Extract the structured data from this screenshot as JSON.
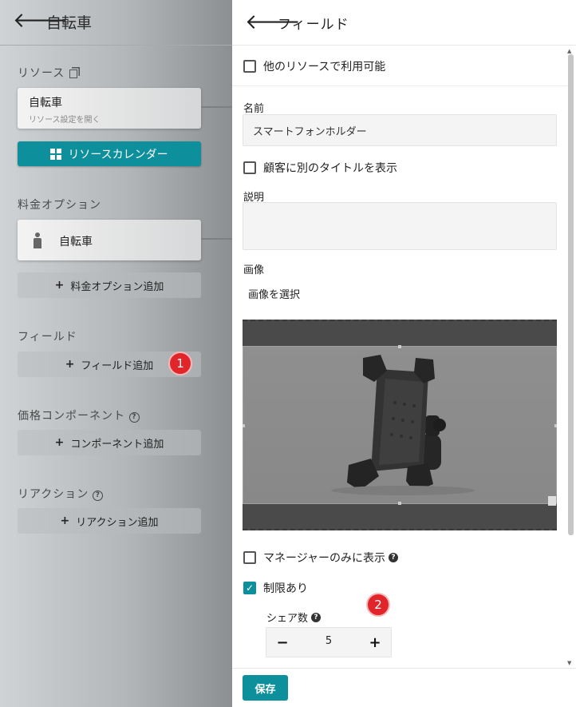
{
  "left_panel": {
    "title": "自転車",
    "resources_label": "リソース",
    "resource_card": {
      "title": "自転車",
      "subtitle": "リソース設定を開く"
    },
    "calendar_button": "リソースカレンダー",
    "price_options_label": "料金オプション",
    "price_option_card": "自転車",
    "add_price_option": "料金オプション追加",
    "fields_label": "フィールド",
    "add_field": "フィールド追加",
    "step1": "1",
    "price_components_label": "価格コンポーネント",
    "add_component": "コンポーネント追加",
    "reactions_label": "リアクション",
    "add_reaction": "リアクション追加"
  },
  "right_panel": {
    "title": "フィールド",
    "available_other_resources": {
      "label": "他のリソースで利用可能",
      "checked": false
    },
    "name_label": "名前",
    "name_value": "スマートフォンホルダー",
    "show_different_title": {
      "label": "顧客に別のタイトルを表示",
      "checked": false
    },
    "description_label": "説明",
    "description_value": "",
    "image_label": "画像",
    "select_image": "画像を選択",
    "manager_only": {
      "label": "マネージャーのみに表示",
      "checked": false
    },
    "limited": {
      "label": "制限あり",
      "checked": true
    },
    "step2": "2",
    "share_count_label": "シェア数",
    "share_count_value": "5",
    "save_button": "保存"
  },
  "icons": {
    "back": "arrow-left-icon",
    "copy": "copy-icon",
    "grid": "grid-icon",
    "person": "person-icon",
    "plus": "plus-icon",
    "help": "question-circle-icon",
    "minus": "minus-icon",
    "check": "check-icon"
  },
  "colors": {
    "accent": "#0e8f9c",
    "badge": "#e0252b"
  }
}
